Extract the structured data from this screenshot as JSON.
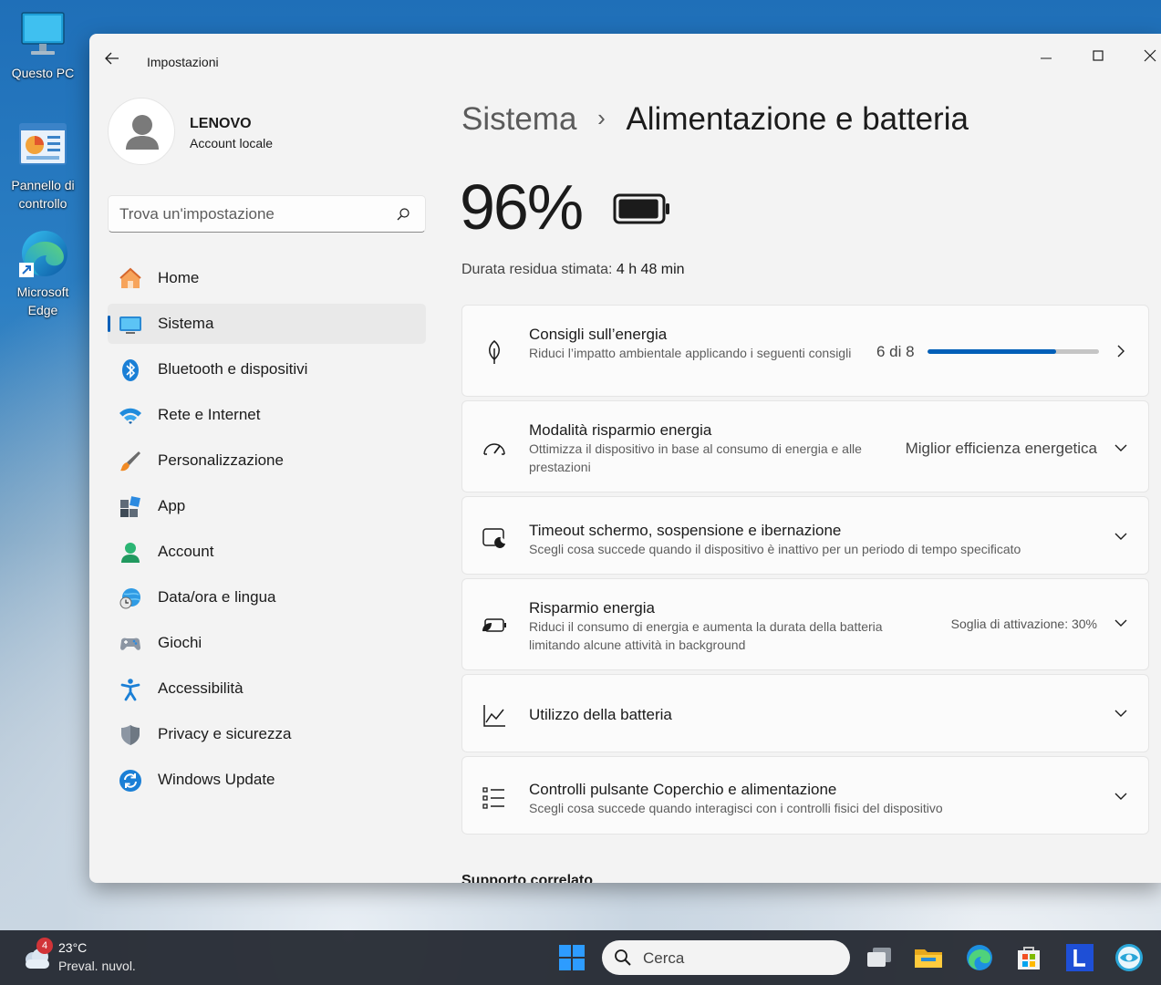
{
  "desktop": {
    "icons": [
      {
        "label": "Questo PC"
      },
      {
        "label": "Pannello di controllo"
      },
      {
        "label": "Microsoft Edge"
      }
    ]
  },
  "window": {
    "title": "Impostazioni"
  },
  "profile": {
    "name": "LENOVO",
    "type": "Account locale"
  },
  "search": {
    "placeholder": "Trova un'impostazione"
  },
  "nav": {
    "items": [
      {
        "label": "Home",
        "icon": "home-icon"
      },
      {
        "label": "Sistema",
        "icon": "monitor-icon"
      },
      {
        "label": "Bluetooth e dispositivi",
        "icon": "bluetooth-icon"
      },
      {
        "label": "Rete e Internet",
        "icon": "wifi-icon"
      },
      {
        "label": "Personalizzazione",
        "icon": "brush-icon"
      },
      {
        "label": "App",
        "icon": "apps-icon"
      },
      {
        "label": "Account",
        "icon": "account-icon"
      },
      {
        "label": "Data/ora e lingua",
        "icon": "globe-clock-icon"
      },
      {
        "label": "Giochi",
        "icon": "gamepad-icon"
      },
      {
        "label": "Accessibilità",
        "icon": "accessibility-icon"
      },
      {
        "label": "Privacy e sicurezza",
        "icon": "shield-icon"
      },
      {
        "label": "Windows Update",
        "icon": "update-icon"
      }
    ],
    "active": "Sistema"
  },
  "breadcrumb": {
    "parent": "Sistema",
    "separator": "›",
    "current": "Alimentazione e batteria"
  },
  "battery": {
    "percent_label": "96%",
    "level": 0.96,
    "duration_label": "Durata residua stimata:",
    "duration_value": "4 h 48 min"
  },
  "cards": {
    "energy_tips": {
      "title": "Consigli sull’energia",
      "desc": "Riduci l’impatto ambientale applicando i seguenti consigli",
      "value": "6 di 8",
      "progress": 0.75
    },
    "power_mode": {
      "title": "Modalità risparmio energia",
      "desc": "Ottimizza il dispositivo in base al consumo di energia e alle prestazioni",
      "value": "Miglior efficienza energetica"
    },
    "screen_timeout": {
      "title": "Timeout schermo, sospensione e ibernazione",
      "desc": "Scegli cosa succede quando il dispositivo è inattivo per un periodo di tempo specificato"
    },
    "battery_saver": {
      "title": "Risparmio energia",
      "desc": "Riduci il consumo di energia e aumenta la durata della batteria limitando alcune attività in background",
      "value": "Soglia di attivazione: 30%"
    },
    "battery_usage": {
      "title": "Utilizzo della batteria"
    },
    "lid_power": {
      "title": "Controlli pulsante Coperchio e alimentazione",
      "desc": "Scegli cosa succede quando interagisci con i controlli fisici del dispositivo"
    }
  },
  "related": {
    "title": "Supporto correlato"
  },
  "taskbar": {
    "weather_badge": "4",
    "temperature": "23°C",
    "condition": "Preval. nuvol.",
    "search_label": "Cerca"
  },
  "colors": {
    "accent": "#005fb8",
    "window_bg": "#f3f3f3",
    "card_bg": "#fbfbfb",
    "taskbar_bg": "#20242c"
  }
}
